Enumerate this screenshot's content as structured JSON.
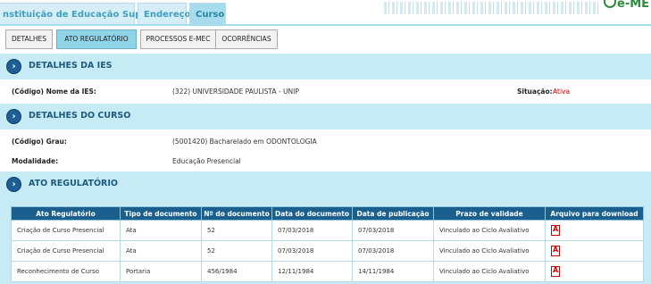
{
  "top_tabs": [
    "nstituição de Educação Superior",
    "Endereço",
    "Curso"
  ],
  "logo_text": "e-ME",
  "sub_tabs": [
    "DETALHES",
    "ATO REGULATÓRIO",
    "PROCESSOS E-MEC",
    "OCORRÊNCIAS"
  ],
  "ies": {
    "title": "DETALHES DA IES",
    "name_label": "(Código) Nome da IES:",
    "name_value": "(322) UNIVERSIDADE PAULISTA - UNIP",
    "situation_label": "Situação:",
    "situation_value": "Ativa"
  },
  "curso": {
    "title": "DETALHES DO CURSO",
    "grau_label": "(Código) Grau:",
    "grau_value": "(5001420) Bacharelado em ODONTOLOGIA",
    "modalidade_label": "Modalidade:",
    "modalidade_value": "Educação Presencial"
  },
  "ato": {
    "title": "ATO REGULATÓRIO",
    "columns": [
      "Ato Regulatório",
      "Tipo de documento",
      "Nº do documento",
      "Data do documento",
      "Data de publicação",
      "Prazo de validade",
      "Arquivo para download"
    ],
    "rows": [
      [
        "Criação de Curso Presencial",
        "Ata",
        "52",
        "07/03/2018",
        "07/03/2018",
        "Vinculado ao Ciclo Avaliativo"
      ],
      [
        "Criação de Curso Presencial",
        "Ata",
        "52",
        "07/03/2018",
        "07/03/2018",
        "Vinculado ao Ciclo Avaliativo"
      ],
      [
        "Reconhecimento de Curso",
        "Portaria",
        "456/1984",
        "12/11/1984",
        "14/11/1984",
        "Vinculado ao Ciclo Avaliativo"
      ]
    ]
  },
  "colors": {
    "header_bg": "#c6ebf5",
    "table_head": "#1a5f8e",
    "active_tab": "#8ed3e6",
    "status_active": "#cc0000"
  }
}
